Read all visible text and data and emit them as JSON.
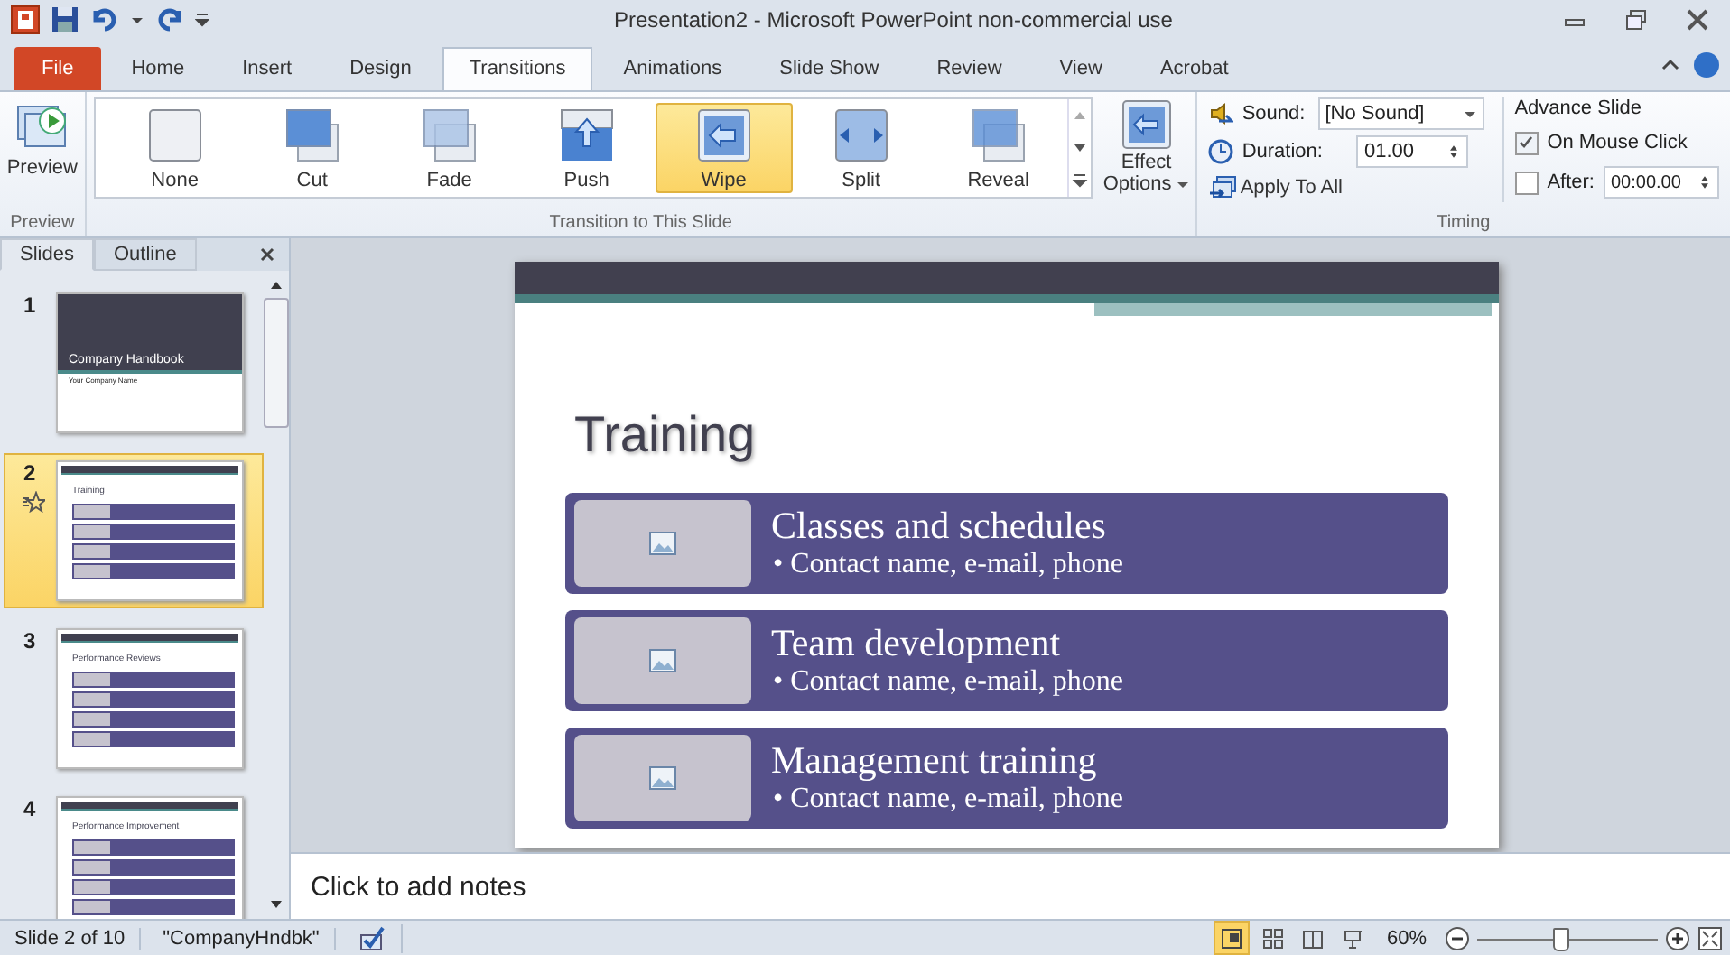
{
  "window": {
    "title": "Presentation2 - Microsoft PowerPoint non-commercial use"
  },
  "tabs": [
    {
      "label": "File",
      "kind": "file",
      "selected": false
    },
    {
      "label": "Home",
      "kind": "tab",
      "selected": false
    },
    {
      "label": "Insert",
      "kind": "tab",
      "selected": false
    },
    {
      "label": "Design",
      "kind": "tab",
      "selected": false
    },
    {
      "label": "Transitions",
      "kind": "tab",
      "selected": true
    },
    {
      "label": "Animations",
      "kind": "tab",
      "selected": false
    },
    {
      "label": "Slide Show",
      "kind": "tab",
      "selected": false
    },
    {
      "label": "Review",
      "kind": "tab",
      "selected": false
    },
    {
      "label": "View",
      "kind": "tab",
      "selected": false
    },
    {
      "label": "Acrobat",
      "kind": "tab",
      "selected": false
    }
  ],
  "ribbon": {
    "preview": {
      "label": "Preview",
      "group": "Preview"
    },
    "transitions": {
      "group": "Transition to This Slide",
      "items": [
        {
          "label": "None",
          "kind": "none",
          "selected": false
        },
        {
          "label": "Cut",
          "kind": "cut",
          "selected": false
        },
        {
          "label": "Fade",
          "kind": "fade",
          "selected": false
        },
        {
          "label": "Push",
          "kind": "push",
          "selected": false
        },
        {
          "label": "Wipe",
          "kind": "wipe",
          "selected": true
        },
        {
          "label": "Split",
          "kind": "split",
          "selected": false
        },
        {
          "label": "Reveal",
          "kind": "reveal",
          "selected": false
        }
      ]
    },
    "effect_options": {
      "line1": "Effect",
      "line2": "Options"
    },
    "timing": {
      "group": "Timing",
      "sound_label": "Sound:",
      "sound": "[No Sound]",
      "duration_label": "Duration:",
      "duration": "01.00",
      "apply_all": "Apply To All",
      "advance_title": "Advance Slide",
      "on_click": {
        "label": "On Mouse Click",
        "checked": true
      },
      "after": {
        "label": "After:",
        "checked": false,
        "value": "00:00.00"
      }
    }
  },
  "panel": {
    "tabs": [
      {
        "label": "Slides",
        "selected": true
      },
      {
        "label": "Outline",
        "selected": false
      }
    ],
    "slides": [
      {
        "number": "1",
        "kind": "title",
        "selected": false,
        "transition": false,
        "title": "Company Handbook",
        "subtitle": "Your Company Name"
      },
      {
        "number": "2",
        "kind": "list",
        "selected": true,
        "transition": true,
        "title": "Training"
      },
      {
        "number": "3",
        "kind": "list",
        "selected": false,
        "transition": false,
        "title": "Performance  Reviews"
      },
      {
        "number": "4",
        "kind": "list",
        "selected": false,
        "transition": false,
        "title": "Performance  Improvement"
      }
    ]
  },
  "slide": {
    "title": "Training",
    "items": [
      {
        "heading": "Classes and schedules",
        "bullet": "• Contact name, e-mail, phone"
      },
      {
        "heading": "Team development",
        "bullet": "• Contact name, e-mail, phone"
      },
      {
        "heading": "Management training",
        "bullet": "• Contact name, e-mail, phone"
      }
    ]
  },
  "notes": {
    "placeholder": "Click to add notes"
  },
  "status_bar": {
    "slide": "Slide 2 of 10",
    "theme": "\"CompanyHndbk\"",
    "zoom": "60%",
    "level": 0.45,
    "views": [
      {
        "kind": "normal",
        "selected": true
      },
      {
        "kind": "sorter",
        "selected": false
      },
      {
        "kind": "reading",
        "selected": false
      },
      {
        "kind": "slideshow",
        "selected": false
      }
    ]
  }
}
